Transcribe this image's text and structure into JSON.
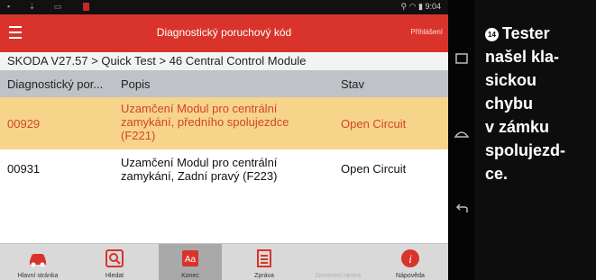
{
  "status_bar": {
    "time": "9:04"
  },
  "header": {
    "title": "Diagnostický poruchový kód",
    "login_label": "Přihlášení"
  },
  "breadcrumb": "SKODA V27.57 > Quick Test > 46 Central Control Module",
  "table": {
    "columns": [
      "Diagnostický por...",
      "Popis",
      "Stav"
    ],
    "rows": [
      {
        "code": "00929",
        "desc": "Uzamčení Modul pro centrální\nzamykání, předního spolujezdce\n(F221)",
        "status": "Open Circuit",
        "selected": true
      },
      {
        "code": "00931",
        "desc": "Uzamčení Modul pro centrální\nzamykání, Zadní pravý (F223)",
        "status": "Open Circuit",
        "selected": false
      }
    ]
  },
  "toolbar": [
    {
      "label": "Hlavní stránka",
      "icon": "car-icon"
    },
    {
      "label": "Hledat",
      "icon": "search-icon"
    },
    {
      "label": "Konec",
      "icon": "clear-code-icon"
    },
    {
      "label": "Zpráva",
      "icon": "report-icon"
    },
    {
      "label": "Zmrazení rámce",
      "icon": "freeze-frame-icon"
    },
    {
      "label": "Nápověda",
      "icon": "help-icon"
    }
  ],
  "caption": {
    "number": "14",
    "text": "Tester\nnašel kla-\nsickou\nchybu\nv zámku\nspolujezd-\nce."
  },
  "colors": {
    "accent": "#d9342b",
    "selected_row": "#f6d48a",
    "selected_text": "#d2452a"
  }
}
